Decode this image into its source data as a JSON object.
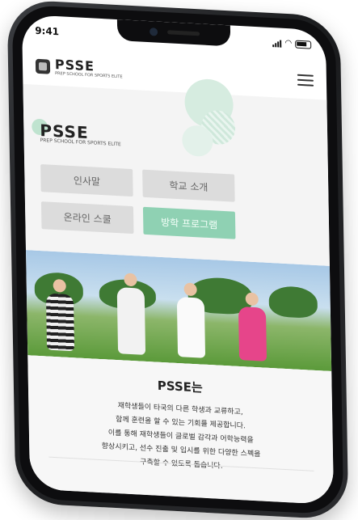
{
  "status_bar": {
    "time": "9:41"
  },
  "header": {
    "brand": "PSSE",
    "brand_sub": "PREP SCHOOL FOR SPORTS ELITE"
  },
  "hero": {
    "brand": "PSSE",
    "brand_sub": "PREP SCHOOL FOR SPORTS ELITE",
    "buttons": [
      {
        "label": "인사말",
        "active": false
      },
      {
        "label": "학교 소개",
        "active": false
      },
      {
        "label": "온라인 스쿨",
        "active": false
      },
      {
        "label": "방학 프로그램",
        "active": true
      }
    ]
  },
  "intro": {
    "title": "PSSE는",
    "lines": [
      "재학생들이 타국의 다른 학생과 교류하고,",
      "함께 훈련을 할 수 있는 기회를 제공합니다.",
      "이를 통해 재학생들이 글로벌 감각과 어학능력을",
      "향상시키고, 선수 진출 및 입시를 위한 다양한 스펙을",
      "구축할 수 있도록 돕습니다."
    ]
  },
  "colors": {
    "accent": "#8fd1b3",
    "button_bg": "#dcdcdc",
    "phone_frame": "#2b2c2f"
  }
}
